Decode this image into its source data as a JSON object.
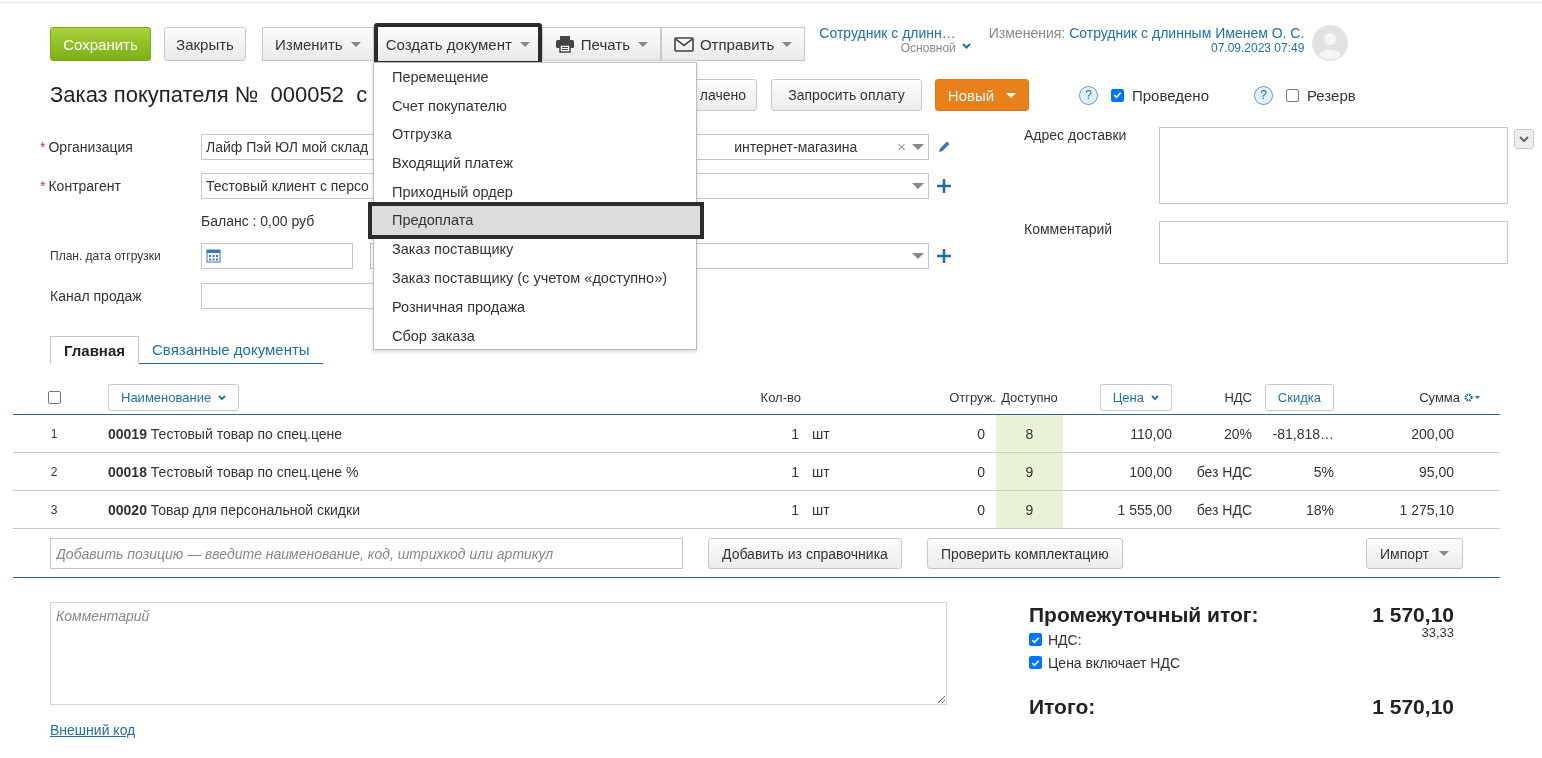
{
  "toolbar": {
    "buttons": [
      {
        "label": "Сохранить",
        "kind": "primary",
        "highlighted": false
      },
      {
        "label": "Закрыть",
        "kind": "plain",
        "highlighted": false
      },
      {
        "label": "Изменить",
        "kind": "dropdown",
        "highlighted": false
      },
      {
        "label": "Создать документ",
        "kind": "dropdown",
        "highlighted": true
      },
      {
        "label": "Печать",
        "kind": "print",
        "highlighted": false
      },
      {
        "label": "Отправить",
        "kind": "send",
        "highlighted": false
      }
    ]
  },
  "owner": {
    "name": "Сотрудник с длинн…",
    "role": "Основной"
  },
  "changes": {
    "label": "Изменения:",
    "author": "Сотрудник с длинным Именем О. С.",
    "date": "07.09.2023 07:49"
  },
  "title": {
    "text": "Заказ покупателя №",
    "number": "000052",
    "rest": "с"
  },
  "status_buttons": [
    {
      "label": "лачено",
      "kind": "plain"
    },
    {
      "label": "Запросить оплату",
      "kind": "plain"
    },
    {
      "label": "Новый",
      "kind": "status"
    }
  ],
  "flags": [
    {
      "help": "?",
      "label": "Проведено",
      "checked": true
    },
    {
      "help": "?",
      "label": "Резерв",
      "checked": false
    }
  ],
  "form": {
    "rows": [
      {
        "kind": "select",
        "required_mark": "*",
        "label": "Организация",
        "value_start": "Лайф Пэй ЮЛ мой склад",
        "value_end": "интернет-магазина",
        "clear": "×"
      },
      {
        "kind": "lookup",
        "required_mark": "*",
        "label": "Контрагент",
        "value_start": "Тестовый клиент с персо"
      },
      {
        "kind": "text",
        "text": "Баланс : 0,00 руб"
      },
      {
        "kind": "date",
        "label": "План. дата отгрузки"
      },
      {
        "kind": "input",
        "label": "Канал продаж"
      }
    ]
  },
  "delivery": {
    "fields": [
      {
        "label": "Адрес доставки",
        "kind": "address"
      },
      {
        "label": "Комментарий",
        "kind": "comment"
      }
    ]
  },
  "tabs": [
    {
      "label": "Главная",
      "selected": true
    },
    {
      "label": "Связанные документы",
      "selected": false
    }
  ],
  "table": {
    "all_checked": false,
    "columns": [
      {
        "label": "Наименование",
        "kind": "sort"
      },
      {
        "label": "Кол-во",
        "kind": "plain"
      },
      {
        "label": "Отгруж.",
        "kind": "plain"
      },
      {
        "label": "Доступно",
        "kind": "plain"
      },
      {
        "label": "Цена",
        "kind": "sort"
      },
      {
        "label": "НДС",
        "kind": "plain"
      },
      {
        "label": "Скидка",
        "kind": "button"
      },
      {
        "label": "Сумма",
        "kind": "settings"
      }
    ],
    "rows": [
      {
        "no": "1",
        "name": "**00019** Тестовый товар по спец.цене",
        "qty": "1",
        "unit": "шт",
        "shipped": "0",
        "available": "8",
        "price": "110,00",
        "vat": "20%",
        "discount": "-81,818…",
        "sum": "200,00"
      },
      {
        "no": "2",
        "name": "**00018** Тестовый товар по спец.цене %",
        "qty": "1",
        "unit": "шт",
        "shipped": "0",
        "available": "9",
        "price": "100,00",
        "vat": "без НДС",
        "discount": "5%",
        "sum": "95,00"
      },
      {
        "no": "3",
        "name": "**00020** Товар для персональной скидки",
        "qty": "1",
        "unit": "шт",
        "shipped": "0",
        "available": "9",
        "price": "1 555,00",
        "vat": "без НДС",
        "discount": "18%",
        "sum": "1 275,10"
      }
    ]
  },
  "add_row": {
    "placeholder": "Добавить позицию — введите наименование, код, штрихкод или артикул",
    "buttons": [
      {
        "label": "Добавить из справочника",
        "kind": "plain"
      },
      {
        "label": "Проверить комплектацию",
        "kind": "plain"
      },
      {
        "label": "Импорт",
        "kind": "menu"
      }
    ]
  },
  "comment": {
    "placeholder": "Комментарий"
  },
  "external_code": "Внешний код",
  "totals": {
    "subtotal_label": "Промежуточный итог:",
    "subtotal": "1 570,10",
    "vat": {
      "label": "НДС:",
      "checked": true,
      "value": "33,33"
    },
    "vat_included": {
      "label": "Цена включает НДС",
      "checked": true
    },
    "total_label": "Итого:",
    "total": "1 570,10"
  },
  "menu": {
    "items": [
      {
        "label": "Перемещение",
        "selected": false,
        "highlighted": false
      },
      {
        "label": "Счет покупателю",
        "selected": false,
        "highlighted": false
      },
      {
        "label": "Отгрузка",
        "selected": false,
        "highlighted": false
      },
      {
        "label": "Входящий платеж",
        "selected": false,
        "highlighted": false
      },
      {
        "label": "Приходный ордер",
        "selected": false,
        "highlighted": false
      },
      {
        "label": "Предоплата",
        "selected": true,
        "highlighted": true
      },
      {
        "label": "Заказ поставщику",
        "selected": false,
        "highlighted": false
      },
      {
        "label": "Заказ поставщику (с учетом «доступно»)",
        "selected": false,
        "highlighted": false
      },
      {
        "label": "Розничная продажа",
        "selected": false,
        "highlighted": false
      },
      {
        "label": "Сбор заказа",
        "selected": false,
        "highlighted": false
      }
    ]
  }
}
